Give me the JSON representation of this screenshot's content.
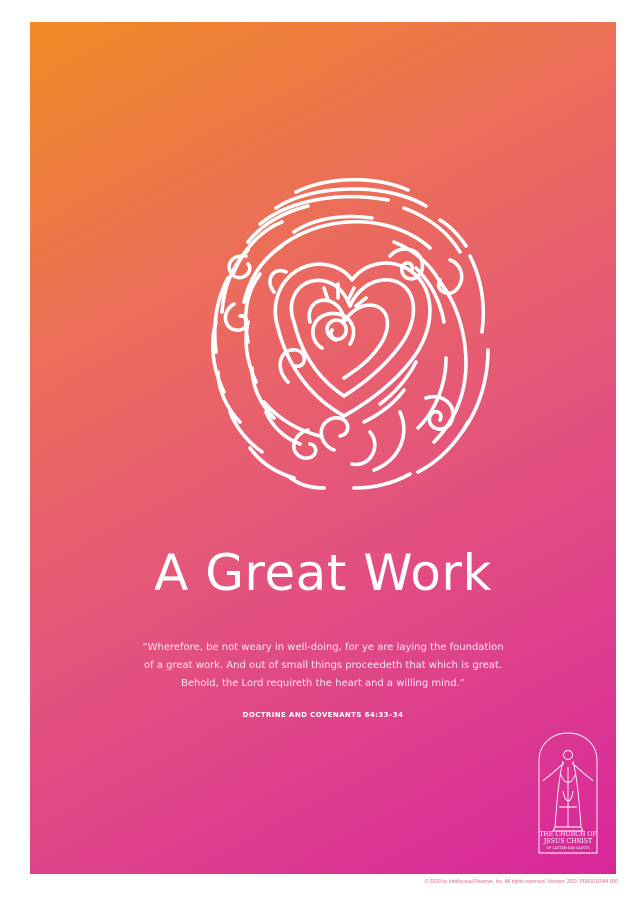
{
  "poster": {
    "title": "A Great Work",
    "quote": [
      "“Wherefore, be not weary in well-doing, for ye are laying the foundation",
      "of a great work. And out of small things proceedeth that which is great.",
      "Behold, the Lord requireth the heart and a willing mind.”"
    ],
    "reference": "DOCTRINE AND COVENANTS 64:33–34",
    "artwork": "fingerprint-heart-illustration",
    "colors": {
      "gradient_start": "#f08a24",
      "gradient_middle": "#e4567a",
      "gradient_end": "#d7269b",
      "text": "#ffffff"
    }
  },
  "logo": {
    "line1": "THE CHURCH OF",
    "line2": "JESUS CHRIST",
    "line3": "OF LATTER-DAY SAINTS",
    "icon": "christus-statue-icon"
  },
  "footer": {
    "copyright": "© 2020 by Intellectual Reserve, Inc. All rights reserved. Version: 3/20. PD60011044 000"
  }
}
